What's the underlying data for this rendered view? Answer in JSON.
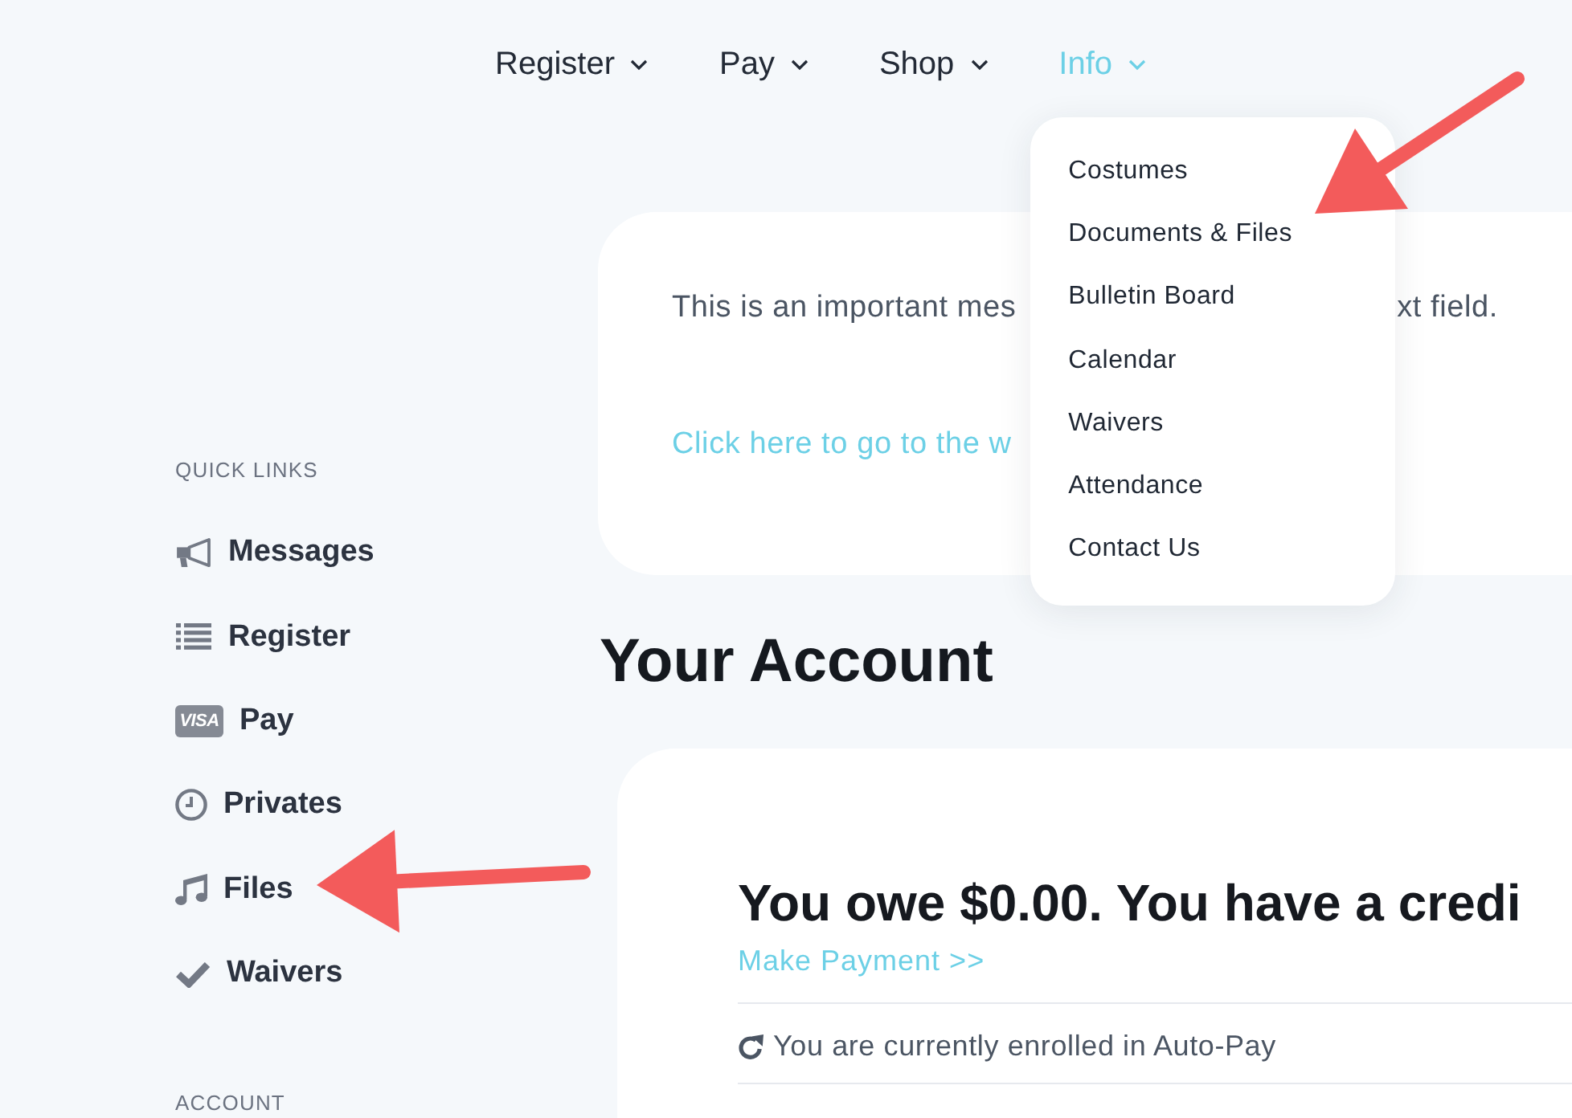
{
  "nav": [
    {
      "label": "Register",
      "expanded": false
    },
    {
      "label": "Pay",
      "expanded": false
    },
    {
      "label": "Shop",
      "expanded": false
    },
    {
      "label": "Info",
      "expanded": true,
      "menu": [
        "Costumes",
        "Documents & Files",
        "Bulletin Board",
        "Calendar",
        "Waivers",
        "Attendance",
        "Contact Us"
      ]
    }
  ],
  "sidebar": [
    {
      "heading": "QUICK LINKS",
      "links": [
        {
          "label": "Messages"
        },
        {
          "label": "Register"
        },
        {
          "label": "Pay",
          "badge": "VISA"
        },
        {
          "label": "Privates"
        },
        {
          "label": "Files"
        },
        {
          "label": "Waivers"
        }
      ]
    },
    {
      "heading": "ACCOUNT"
    }
  ],
  "message_card": {
    "text_parts": [
      "This is an important mes",
      "xt field."
    ],
    "link": "Click here to go to the w"
  },
  "page_title": "Your Account",
  "account_card": {
    "balance": "You owe $0.00. You have a credi",
    "payment_link": "Make Payment >>",
    "autopay_status": "You are currently enrolled in Auto-Pay"
  }
}
